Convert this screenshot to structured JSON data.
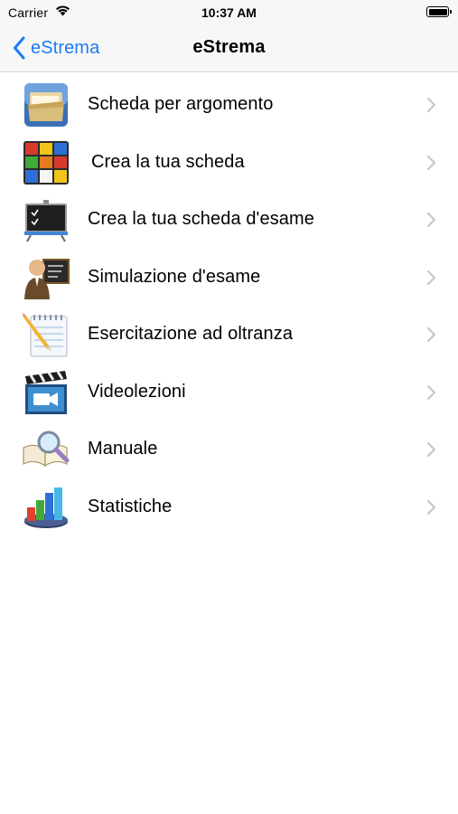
{
  "status_bar": {
    "carrier": "Carrier",
    "time": "10:37 AM"
  },
  "nav_bar": {
    "back_label": "eStrema",
    "title": "eStrema"
  },
  "menu": {
    "items": [
      {
        "label": "Scheda per argomento",
        "icon": "folder-icon"
      },
      {
        "label": "Crea la tua scheda",
        "icon": "quiz-cube-icon"
      },
      {
        "label": "Crea la tua scheda d'esame",
        "icon": "chalkboard-icon"
      },
      {
        "label": "Simulazione d'esame",
        "icon": "teacher-icon"
      },
      {
        "label": "Esercitazione ad oltranza",
        "icon": "notepad-pencil-icon"
      },
      {
        "label": "Videolezioni",
        "icon": "clapperboard-icon"
      },
      {
        "label": "Manuale",
        "icon": "book-magnifier-icon"
      },
      {
        "label": "Statistiche",
        "icon": "bar-chart-icon"
      }
    ]
  },
  "colors": {
    "accent": "#1a7cf4",
    "chevron": "#c7c7cc",
    "bar_background": "#f7f7f7"
  }
}
